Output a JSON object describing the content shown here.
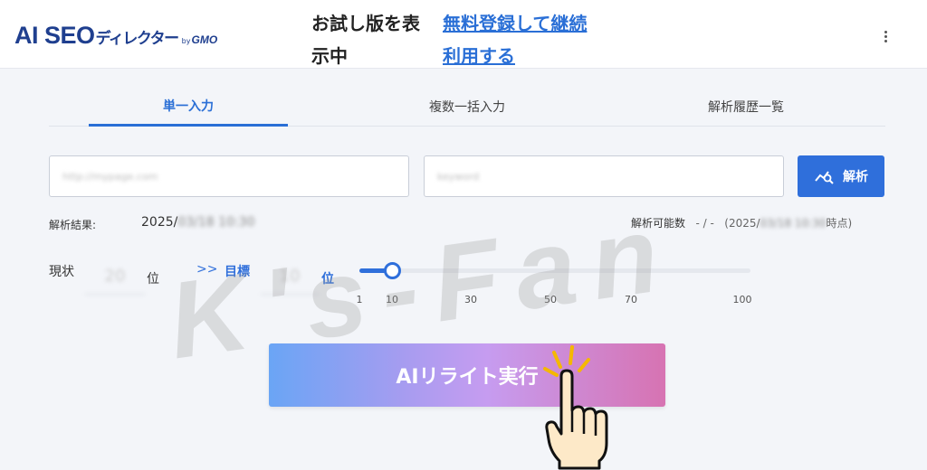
{
  "header": {
    "logo_main": "AI SEO",
    "logo_sub": "ディレクター",
    "logo_by": "by",
    "logo_gmo": "GMO",
    "trial_status": "お試し版を表示中",
    "register_link": "無料登録して継続利用する",
    "menu_icon": "more-vertical-icon"
  },
  "tabs": [
    {
      "label": "単一入力",
      "active": true
    },
    {
      "label": "複数一括入力",
      "active": false
    },
    {
      "label": "解析履歴一覧",
      "active": false
    }
  ],
  "form": {
    "url_placeholder": "http://mypage.com",
    "keyword_placeholder": "keyword",
    "analyze_label": "解析",
    "analyze_icon": "chart-search-icon"
  },
  "results": {
    "label": "解析結果:",
    "date_visible": "2025/",
    "date_hidden": "03/18 10:30",
    "remaining_label": "解析可能数",
    "remaining_value": "- / -",
    "remaining_date_prefix": "(2025/",
    "remaining_date_hidden": "03/18 10:30",
    "remaining_date_suffix": "時点)"
  },
  "ranking": {
    "current_label": "現状",
    "current_value": "20",
    "rank_unit": "位",
    "arrow": ">>",
    "target_label": "目標",
    "target_value": "10",
    "target_unit": "位",
    "slider_ticks": [
      "1",
      "10",
      "30",
      "50",
      "70",
      "100"
    ],
    "slider_value": 10
  },
  "action": {
    "rewrite_label": "AIリライト実行",
    "pointer_icon": "pointing-hand-icon"
  },
  "watermark": "K's-Fan",
  "colors": {
    "accent": "#2f6fdb",
    "logo": "#1f3f8f",
    "link": "#2a6fd6",
    "gradient_start": "#6aa5f5",
    "gradient_end": "#d773b2"
  }
}
